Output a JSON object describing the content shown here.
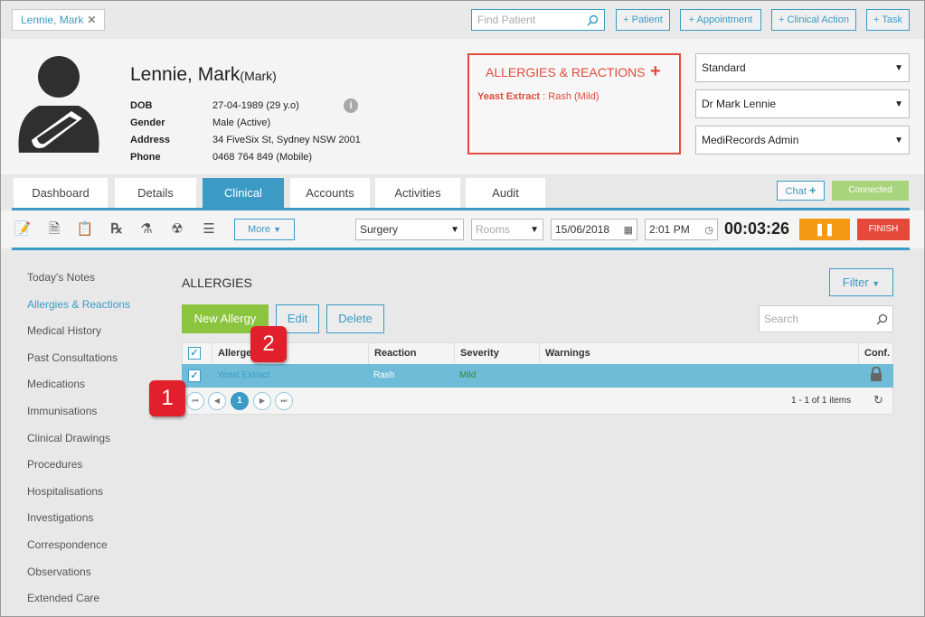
{
  "topbar": {
    "patient_tab": "Lennie, Mark",
    "find_placeholder": "Find Patient",
    "buttons": [
      "+ Patient",
      "+ Appointment",
      "+ Clinical Action",
      "+ Task"
    ]
  },
  "patient": {
    "name": "Lennie, Mark",
    "preferred": "(Mark)",
    "fields": [
      {
        "label": "DOB",
        "value": "27-04-1989 (29 y.o)"
      },
      {
        "label": "Gender",
        "value": "Male (Active)"
      },
      {
        "label": "Address",
        "value": "34 FiveSix St, Sydney NSW 2001"
      },
      {
        "label": "Phone",
        "value": "0468 764 849 (Mobile)"
      }
    ]
  },
  "allergy_box": {
    "title": "ALLERGIES & REACTIONS",
    "item_name": "Yeast Extract",
    "item_detail": " : Rash (Mild)"
  },
  "selects": [
    "Standard",
    "Dr Mark Lennie",
    "MediRecords Admin"
  ],
  "tabs": [
    "Dashboard",
    "Details",
    "Clinical",
    "Accounts",
    "Activities",
    "Audit"
  ],
  "active_tab": "Clinical",
  "chat_label": "Chat",
  "connected_label": "Connected",
  "toolbar": {
    "more_label": "More",
    "location": "Surgery",
    "rooms_placeholder": "Rooms",
    "date": "15/06/2018",
    "time": "2:01 PM",
    "timer": "00:03:26",
    "finish_label": "FINISH"
  },
  "sidenav": [
    "Today's Notes",
    "Allergies & Reactions",
    "Medical History",
    "Past Consultations",
    "Medications",
    "Immunisations",
    "Clinical Drawings",
    "Procedures",
    "Hospitalisations",
    "Investigations",
    "Correspondence",
    "Observations",
    "Extended Care"
  ],
  "sidenav_active": "Allergies & Reactions",
  "allergies": {
    "heading": "ALLERGIES",
    "filter_label": "Filter",
    "new_label": "New Allergy",
    "edit_label": "Edit",
    "delete_label": "Delete",
    "search_placeholder": "Search",
    "columns": [
      "Allergen",
      "Reaction",
      "Severity",
      "Warnings",
      "Conf."
    ],
    "rows": [
      {
        "allergen": "Yeast Extract",
        "reaction": "Rash",
        "severity": "Mild",
        "warnings": ""
      }
    ],
    "page": "1",
    "page_info": "1 - 1 of 1 items"
  },
  "annotations": [
    "1",
    "2"
  ],
  "colors": {
    "accent": "#3b9bc4",
    "alert": "#e04b3c",
    "success": "#8bc43e",
    "pause": "#f39a12"
  }
}
